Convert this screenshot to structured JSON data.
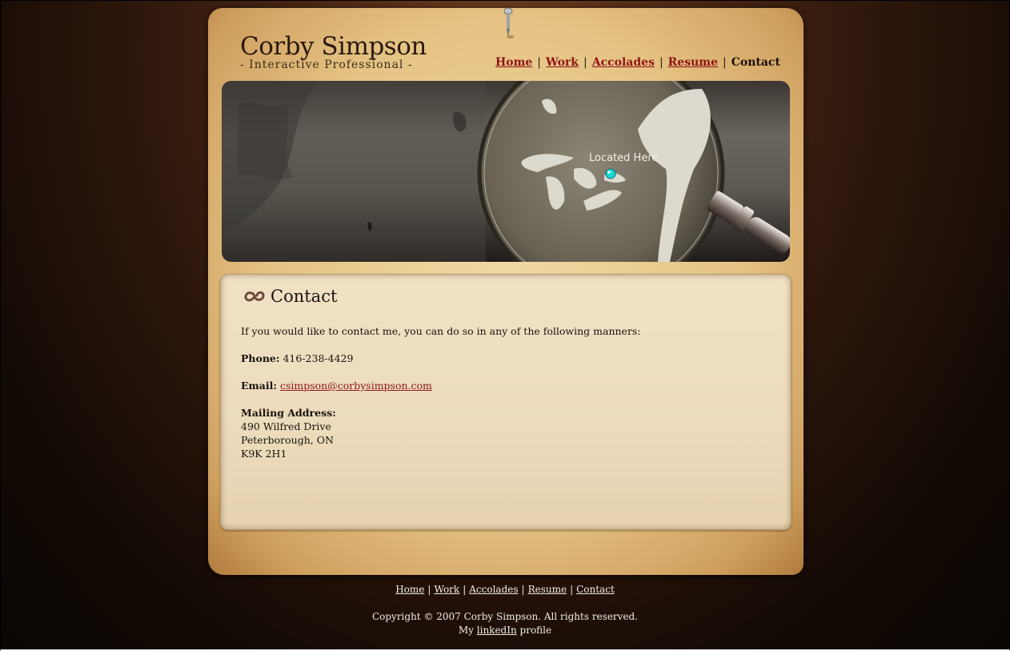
{
  "brand": {
    "name": "Corby Simpson",
    "tagline": "- Interactive Professional -"
  },
  "nav": {
    "items": [
      {
        "label": "Home"
      },
      {
        "label": "Work"
      },
      {
        "label": "Accolades"
      },
      {
        "label": "Resume"
      },
      {
        "label": "Contact"
      }
    ],
    "current": "Contact",
    "separator": "|"
  },
  "banner": {
    "located_label": "Located Here",
    "marker_color": "#19d6d6"
  },
  "contact": {
    "title": "Contact",
    "intro": "If you would like to contact me, you can do so in any of the following manners:",
    "phone_label": "Phone:",
    "phone_value": "416-238-4429",
    "email_label": "Email:",
    "email_value": "csimpson@corbysimpson.com",
    "address_label": "Mailing Address:",
    "address_lines": [
      "490 Wilfred Drive",
      "Peterborough, ON",
      "K9K 2H1"
    ]
  },
  "footer": {
    "links": [
      {
        "label": "Home"
      },
      {
        "label": "Work"
      },
      {
        "label": "Accolades"
      },
      {
        "label": "Resume"
      },
      {
        "label": "Contact"
      }
    ],
    "separator": "|",
    "copyright": "Copyright © 2007 Corby Simpson. All rights reserved.",
    "linkedin_prefix": "My",
    "linkedin_link": "linkedIn",
    "linkedin_suffix": "profile"
  },
  "colors": {
    "link": "#8f1414",
    "accent_marker": "#19d6d6"
  }
}
